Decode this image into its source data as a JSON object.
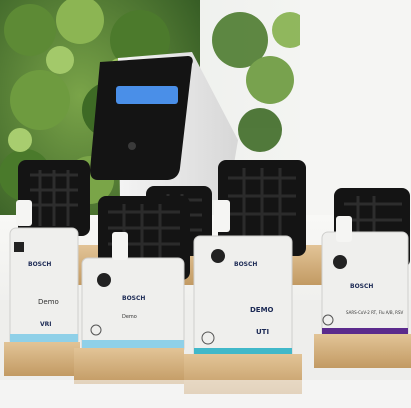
{
  "photo": {
    "subject": "Bosch Vivalytic diagnostic test cartridges on wooden stands with analyzer in background",
    "palette": {
      "foliage": "#3f6b2a",
      "foliage_light": "#6f9a3e",
      "wall": "#f3f3f1",
      "table": "#f6f6f4",
      "wood": "#d9b98a",
      "wood_dark": "#b8935d",
      "cartridge_black": "#141414",
      "cartridge_white": "#eeeeec",
      "accent_blue": "#8fd0e8",
      "accent_teal": "#41b8c9",
      "accent_purple": "#5b2a8c",
      "device_screen": "#4a8fe8"
    }
  },
  "cartridges": [
    {
      "brand": "BOSCH",
      "label": "Demo",
      "panel": "VRI",
      "accent": "#8fd0e8"
    },
    {
      "brand": "BOSCH",
      "label": "Demo",
      "panel": "",
      "accent": "#8fd0e8"
    },
    {
      "brand": "BOSCH",
      "label": "DEMO",
      "panel": "UTI",
      "accent": "#41b8c9"
    },
    {
      "brand": "BOSCH",
      "label": "",
      "panel": "SARS-CoV-2 RT, Flu A/B, RSV",
      "accent": "#5b2a8c"
    }
  ]
}
